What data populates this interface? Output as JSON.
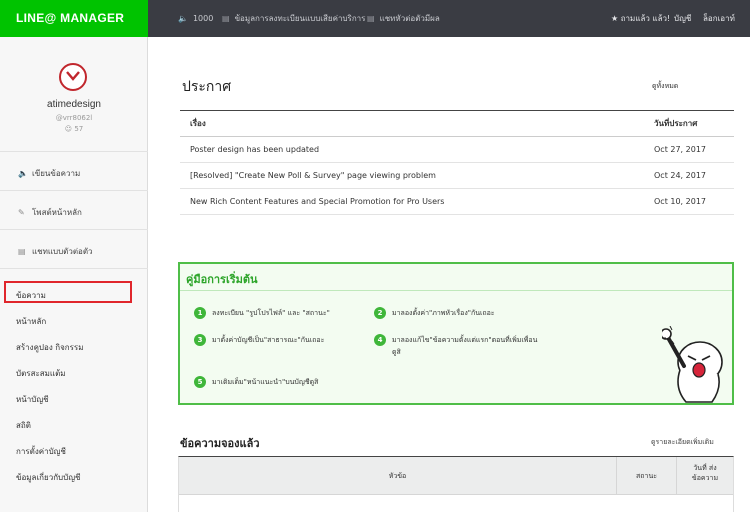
{
  "header": {
    "brand": "LINE@ MANAGER",
    "message_count": "1000",
    "register_info": "ข้อมูลการลงทะเบียนแบบเสียค่าบริการ",
    "one_on_one_chat": "แชทหัวต่อตัวมีผล",
    "user_menu": "★ ถามแล้ว แล้ว!",
    "account": "บัญชี",
    "logout": "ล็อกเอาท์"
  },
  "sidebar": {
    "account_name": "atimedesign",
    "account_id": "@vrr8062l",
    "followers": "57",
    "primary": [
      {
        "label": "เขียนข้อความ",
        "icon": "megaphone-icon"
      },
      {
        "label": "โพสต์หน้าหลัก",
        "icon": "edit-icon"
      },
      {
        "label": "แชทแบบตัวต่อตัว",
        "icon": "chat-icon"
      }
    ],
    "links": [
      "ข้อความ",
      "หน้าหลัก",
      "สร้างคูปอง กิจกรรม",
      "บัตรสะสมแต้ม",
      "หน้าบัญชี",
      "สถิติ",
      "การตั้งค่าบัญชี",
      "ข้อมูลเกี่ยวกับบัญชี"
    ]
  },
  "announcements": {
    "title": "ประกาศ",
    "see_all": "ดูทั้งหมด",
    "col_subject": "เรื่อง",
    "col_date": "วันที่ประกาศ",
    "rows": [
      {
        "subject": "Poster design has been updated",
        "date": "Oct 27, 2017"
      },
      {
        "subject": "[Resolved] \"Create New Poll & Survey\" page viewing problem",
        "date": "Oct 24, 2017"
      },
      {
        "subject": "New Rich Content Features and Special Promotion for Pro Users",
        "date": "Oct 10, 2017"
      }
    ]
  },
  "guide": {
    "title": "คู่มือการเริ่มต้น",
    "steps": [
      {
        "num": "1",
        "text": "ลงทะเบียน \"รูปโปรไฟล์\" และ \"สถานะ\""
      },
      {
        "num": "2",
        "text": "มาลองตั้งค่า\"ภาพหัวเรื่อง\"กันเถอะ"
      },
      {
        "num": "3",
        "text": "มาตั้งค่าบัญชีเป็น\"สาธารณะ\"กันเถอะ"
      },
      {
        "num": "4",
        "text": "มาลองแก้ไข\"ข้อความตั้งแต่แรก\"ตอนที่เพิ่มเพื่อน",
        "text2": "ดูสิ"
      },
      {
        "num": "5",
        "text": "มาเติมเต็ม\"หน้าแนะนำ\"บนบัญชีดูสิ"
      }
    ]
  },
  "scheduled": {
    "title": "ข้อความจองแล้ว",
    "view_more": "ดูรายละเอียดเพิ่มเติม",
    "col_subject": "หัวข้อ",
    "col_status": "สถานะ",
    "col_date_line1": "วันที่ ส่ง",
    "col_date_line2": "ข้อความ"
  },
  "colors": {
    "brand_green": "#00c300",
    "topbar": "#3a3c43",
    "guide_border": "#4fbe48",
    "highlight_red": "#e0262c"
  }
}
